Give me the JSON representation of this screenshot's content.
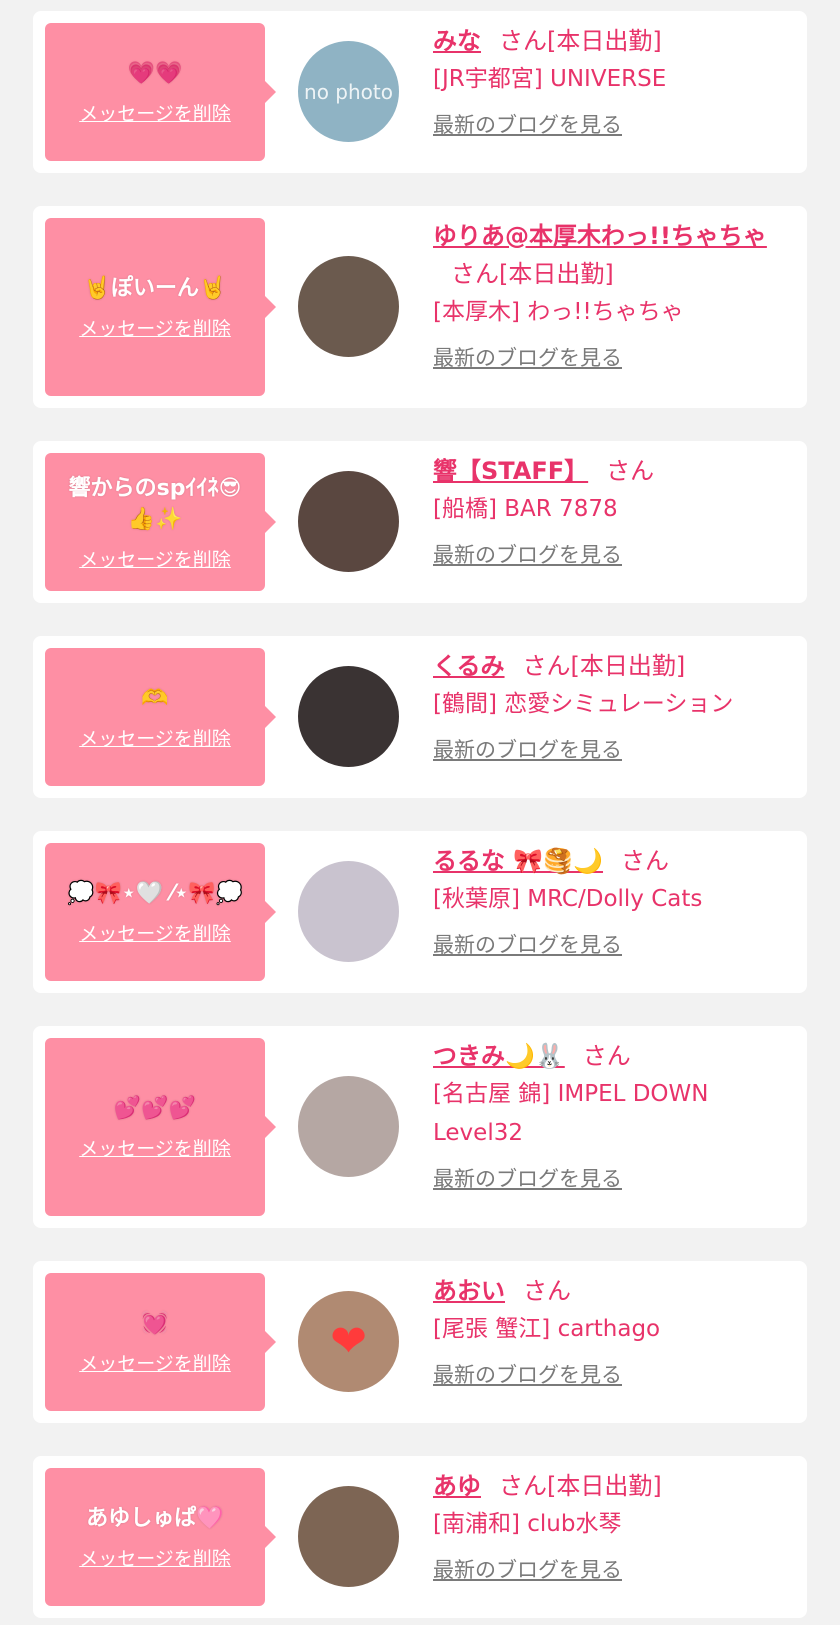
{
  "delete_label": "メッセージを削除",
  "blog_label": "最新のブログを見る",
  "colors": {
    "background": "#f2f2f2",
    "card": "#ffffff",
    "bubble": "#fe8fa4",
    "accent_text": "#e8336a",
    "link_gray": "#7a7a7a"
  },
  "items": [
    {
      "message": "💗💗",
      "avatar": {
        "icon": "no-photo-placeholder",
        "text": "no photo",
        "color": "#8fb3c4"
      },
      "name": "みな",
      "suffix": "さん[本日出勤]",
      "shop": "[JR宇都宮] UNIVERSE"
    },
    {
      "message": "🤘ぽいーん🤘",
      "avatar": {
        "icon": "photo-avatar",
        "text": "",
        "color": "#6b5a4e"
      },
      "name": "ゆりあ@本厚木わっ!!ちゃちゃ",
      "suffix": "さん[本日出勤]",
      "shop": "[本厚木] わっ!!ちゃちゃ"
    },
    {
      "message": "響からのspｲｲﾈ😎\n👍✨",
      "avatar": {
        "icon": "photo-avatar",
        "text": "",
        "color": "#5a4740"
      },
      "name": "響【STAFF】",
      "suffix": "さん",
      "shop": "[船橋] BAR 7878"
    },
    {
      "message": "🫶",
      "avatar": {
        "icon": "photo-avatar",
        "text": "",
        "color": "#3a3333"
      },
      "name": "くるみ",
      "suffix": "さん[本日出勤]",
      "shop": "[鶴間] 恋愛シミュレーション"
    },
    {
      "message": "💭🎀⋆🤍 ⁄⋆🎀💭",
      "avatar": {
        "icon": "photo-avatar",
        "text": "",
        "color": "#c9c3cf"
      },
      "name": "るるな 🎀🥞🌙",
      "suffix": "さん",
      "shop": "[秋葉原] MRC/Dolly Cats"
    },
    {
      "message": "💕💕💕",
      "avatar": {
        "icon": "photo-avatar",
        "text": "",
        "color": "#b5a7a3"
      },
      "name": "つきみ🌙🐰",
      "suffix": "さん",
      "shop": "[名古屋 錦] IMPEL DOWN Level32"
    },
    {
      "message": "💓",
      "avatar": {
        "icon": "heart-avatar",
        "text": "❤",
        "color": "#b08a72"
      },
      "name": "あおい",
      "suffix": "さん",
      "shop": "[尾張 蟹江] carthago"
    },
    {
      "message": "あゆしゅぱ🩷",
      "avatar": {
        "icon": "photo-avatar",
        "text": "",
        "color": "#7d6554"
      },
      "name": "あゆ",
      "suffix": "さん[本日出勤]",
      "shop": "[南浦和] club水琴"
    }
  ]
}
